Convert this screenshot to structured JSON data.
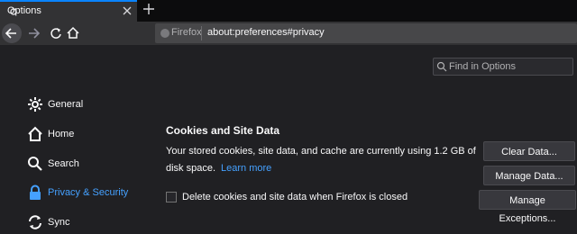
{
  "tab": {
    "title": "Options"
  },
  "urlbar": {
    "identity_label": "Firefox",
    "url": "about:preferences#privacy"
  },
  "search": {
    "placeholder": "Find in Options"
  },
  "sidebar": {
    "items": [
      {
        "label": "General",
        "icon": "gear-icon"
      },
      {
        "label": "Home",
        "icon": "home-icon"
      },
      {
        "label": "Search",
        "icon": "search-icon"
      },
      {
        "label": "Privacy & Security",
        "icon": "lock-icon",
        "selected": true
      },
      {
        "label": "Sync",
        "icon": "sync-icon"
      }
    ]
  },
  "cookies": {
    "title": "Cookies and Site Data",
    "description": "Your stored cookies, site data, and cache are currently using 1.2 GB of disk space.",
    "learn_more": "Learn more",
    "clear_label": "Clear Data...",
    "manage_label": "Manage Data...",
    "exceptions_label": "Manage Exceptions...",
    "delete_on_close_label": "Delete cookies and site data when Firefox is closed",
    "delete_on_close_checked": false
  },
  "colors": {
    "accent": "#0a84ff",
    "link": "#45a1ff",
    "background": "#202023",
    "toolbar": "#323234"
  }
}
